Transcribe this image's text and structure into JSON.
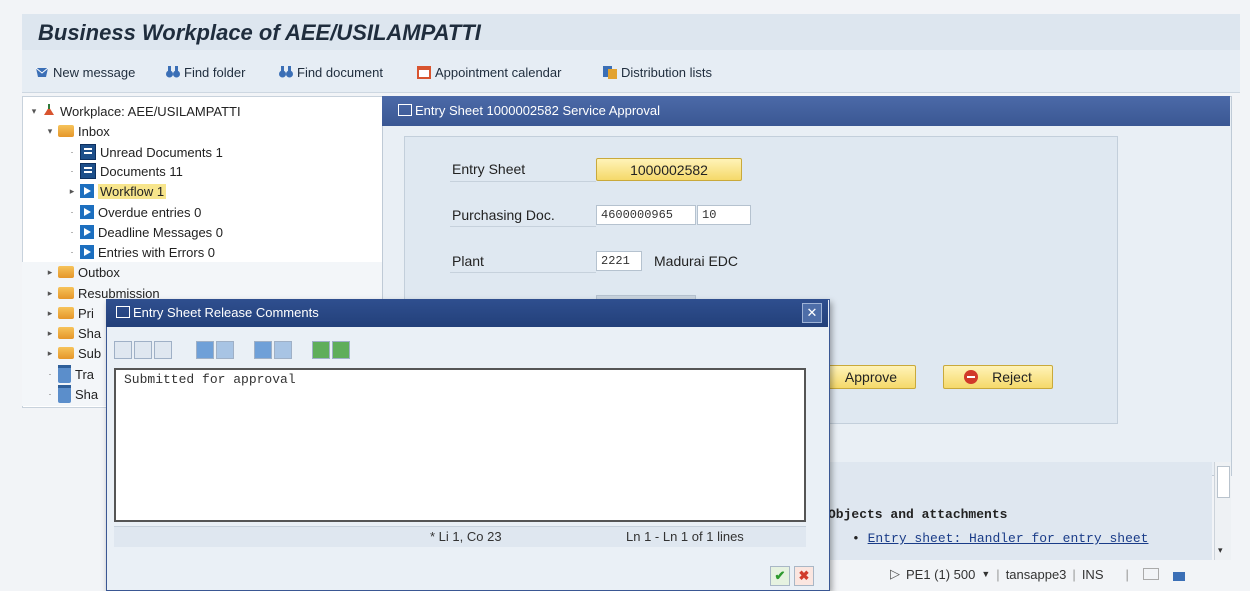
{
  "app": {
    "title": "Business Workplace of AEE/USILAMPATTI"
  },
  "toolbar": {
    "new_message": "New message",
    "find_folder": "Find folder",
    "find_document": "Find document",
    "appointment_calendar": "Appointment calendar",
    "distribution_lists": "Distribution lists"
  },
  "tree": {
    "root": "Workplace: AEE/USILAMPATTI",
    "inbox": "Inbox",
    "inbox_items": [
      "Unread Documents 1",
      "Documents 11",
      "Workflow 1",
      "Overdue entries 0",
      "Deadline Messages 0",
      "Entries with Errors 0"
    ],
    "outbox": "Outbox",
    "resubmission": "Resubmission",
    "partial": [
      "Pri",
      "Sha",
      "Sub",
      "Tra",
      "Sha"
    ]
  },
  "entry_panel": {
    "title": "Entry Sheet 1000002582 Service Approval",
    "entry_sheet_label": "Entry Sheet",
    "entry_sheet_value": "1000002582",
    "purchasing_doc_label": "Purchasing Doc.",
    "purchasing_doc_value": "4600000965",
    "purchasing_doc_item": "10",
    "plant_label": "Plant",
    "plant_value": "2221",
    "plant_name": "Madurai EDC",
    "approve_label": "Approve",
    "reject_label": "Reject"
  },
  "doc_area": {
    "heading": "Objects and attachments",
    "bullet": "•",
    "link": "Entry sheet: Handler for entry sheet"
  },
  "dialog": {
    "title": "Entry Sheet Release Comments",
    "comment_text": "Submitted for approval",
    "cursor_pos": "* Li 1, Co 23",
    "line_info": "Ln 1 - Ln 1 of 1 lines"
  },
  "status_bar": {
    "system": "PE1 (1) 500",
    "user": "tansappe3",
    "mode": "INS"
  },
  "colors": {
    "accent": "#3a5793",
    "highlight": "#f7e58c",
    "button": "#f5d96a"
  }
}
